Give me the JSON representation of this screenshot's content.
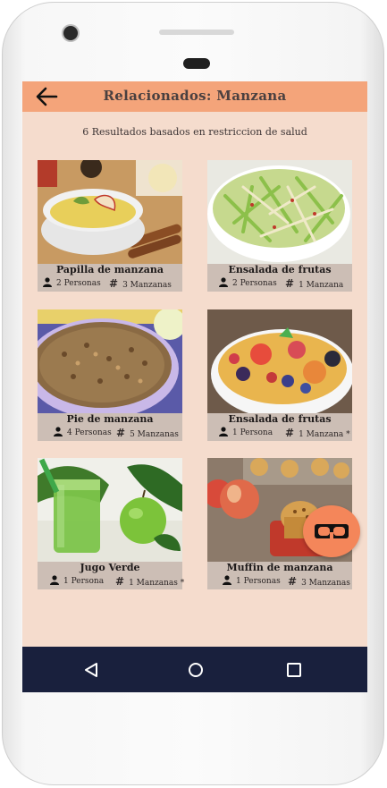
{
  "appbar": {
    "title": "Relacionados: Manzana"
  },
  "subtitle": "6 Resultados basados en restriccion de salud",
  "cards": [
    {
      "name": "Papilla de manzana",
      "persons": "2 Personas",
      "apples": "3 Manzanas"
    },
    {
      "name": "Ensalada de frutas",
      "persons": "2 Personas",
      "apples": "1 Manzana"
    },
    {
      "name": "Pie de manzana",
      "persons": "4 Personas",
      "apples": "5 Manzanas"
    },
    {
      "name": "Ensalada de frutas",
      "persons": "1 Persona",
      "apples": "1 Manzana *"
    },
    {
      "name": "Jugo Verde",
      "persons": "1 Persona",
      "apples": "1 Manzanas *"
    },
    {
      "name": "Muffin de manzana",
      "persons": "1 Personas",
      "apples": "3 Manzanas"
    }
  ],
  "icons": {
    "back": "arrow-left-icon",
    "person": "person-icon",
    "hash": "hash-icon",
    "fab": "glasses-icon",
    "nav_back": "triangle-back-icon",
    "nav_home": "circle-home-icon",
    "nav_recent": "square-recent-icon"
  },
  "colors": {
    "appbar": "#f4a47a",
    "screen_bg": "#f5dccd",
    "card_bg": "#ccbeb5",
    "fab": "#f4865a",
    "navbar": "#19203d"
  }
}
